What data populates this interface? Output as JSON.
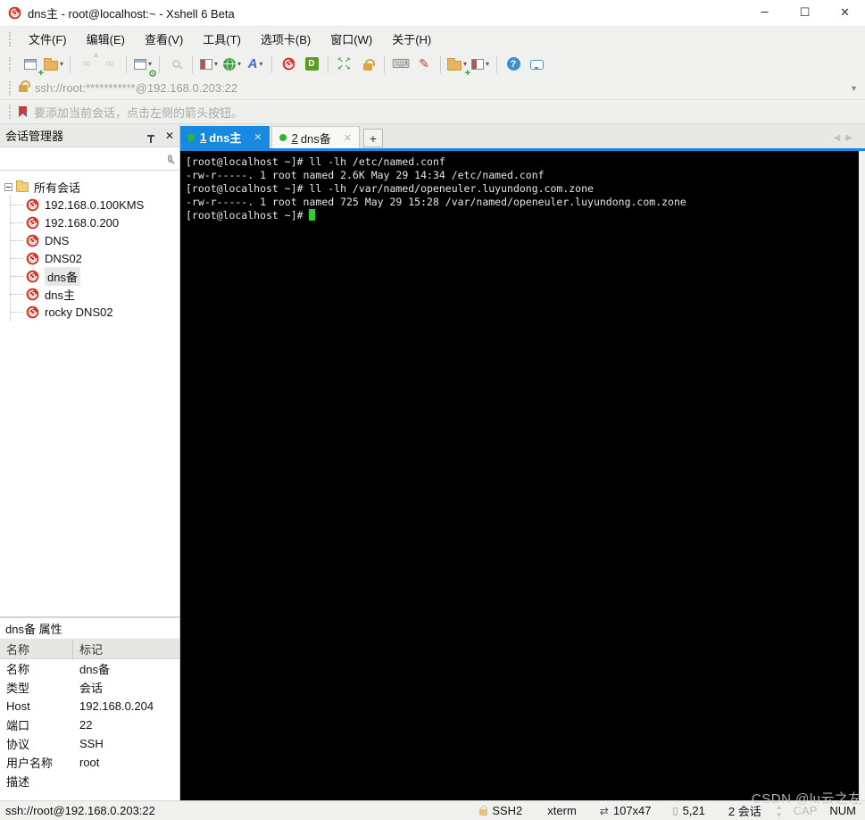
{
  "window": {
    "title": "dns主 - root@localhost:~ - Xshell 6 Beta"
  },
  "menu": {
    "items": [
      "文件(F)",
      "编辑(E)",
      "查看(V)",
      "工具(T)",
      "选项卡(B)",
      "窗口(W)",
      "关于(H)"
    ]
  },
  "toolbar": {
    "icon_names": [
      "new-session",
      "open-folder",
      "disconnect",
      "reconnect",
      "session-properties",
      "find",
      "layout",
      "encoding-globe",
      "font",
      "xshell",
      "xftp",
      "fullscreen",
      "lock-screen",
      "virtual-keyboard",
      "compose-pen",
      "new-session-folder",
      "split-panes",
      "help",
      "feedback"
    ]
  },
  "address_bar": {
    "url": "ssh://root:***********@192.168.0.203:22"
  },
  "info_bar": {
    "message": "要添加当前会话，点击左侧的箭头按钮。"
  },
  "session_manager": {
    "title": "会话管理器",
    "root_label": "所有会话",
    "items": [
      {
        "label": "192.168.0.100KMS"
      },
      {
        "label": "192.168.0.200"
      },
      {
        "label": "DNS"
      },
      {
        "label": "DNS02"
      },
      {
        "label": "dns备"
      },
      {
        "label": "dns主"
      },
      {
        "label": "rocky DNS02"
      }
    ]
  },
  "tabs": {
    "items": [
      {
        "num": "1",
        "label": "dns主",
        "active": true
      },
      {
        "num": "2",
        "label": "dns备",
        "active": false
      }
    ],
    "add_label": "+"
  },
  "terminal": {
    "lines": [
      "[root@localhost ~]# ll -lh /etc/named.conf",
      "-rw-r-----. 1 root named 2.6K May 29 14:34 /etc/named.conf",
      "[root@localhost ~]# ll -lh /var/named/openeuler.luyundong.com.zone",
      "-rw-r-----. 1 root named 725 May 29 15:28 /var/named/openeuler.luyundong.com.zone",
      "[root@localhost ~]# "
    ]
  },
  "properties": {
    "title": "dns备 属性",
    "columns": [
      "名称",
      "标记"
    ],
    "rows": [
      {
        "label": "名称",
        "value": "dns备"
      },
      {
        "label": "类型",
        "value": "会话"
      },
      {
        "label": "Host",
        "value": "192.168.0.204"
      },
      {
        "label": "端口",
        "value": "22"
      },
      {
        "label": "协议",
        "value": "SSH"
      },
      {
        "label": "用户名称",
        "value": "root"
      },
      {
        "label": "描述",
        "value": ""
      }
    ]
  },
  "status_bar": {
    "connection": "ssh://root@192.168.0.203:22",
    "protocol": "SSH2",
    "terminal_type": "xterm",
    "screen_size": "107x47",
    "cursor_position": "5,21",
    "session_count": "2 会话",
    "cap_indicator": "CAP",
    "num_indicator": "NUM"
  },
  "watermark": "CSDN @lu云之左",
  "colors": {
    "accent_blue": "#1789e0",
    "terminal_green": "#33cc33",
    "xshell_red": "#d6362a",
    "folder_tan": "#e8b55e"
  }
}
